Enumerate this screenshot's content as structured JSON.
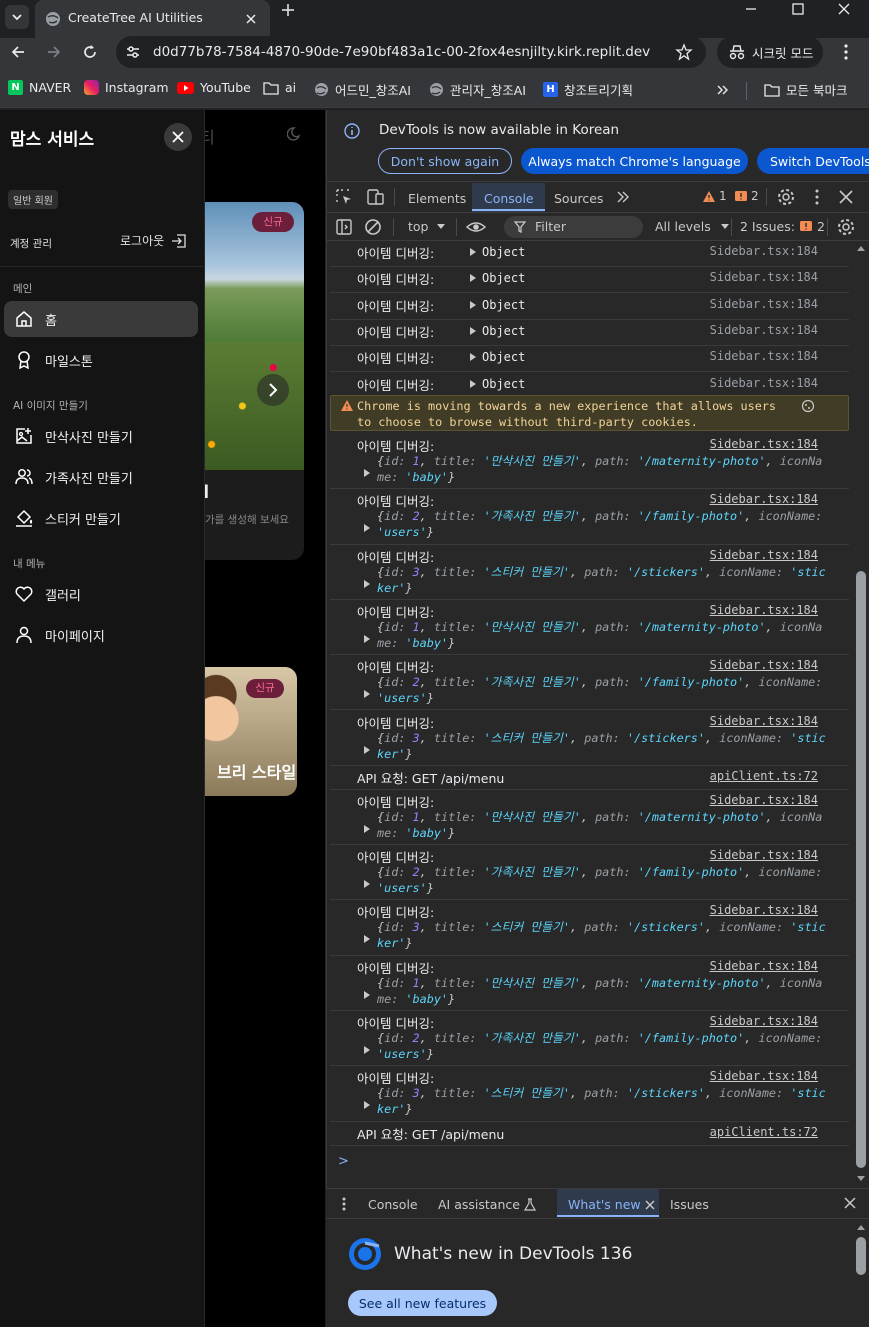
{
  "browser": {
    "tab_title": "CreateTree AI Utilities",
    "url": "d0d77b78-7584-4870-90de-7e90bf483a1c-00-2fox4esnjilty.kirk.replit.dev",
    "incognito_label": "시크릿 모드",
    "bookmarks": [
      {
        "label": "NAVER",
        "icon": "naver-icon"
      },
      {
        "label": "Instagram",
        "icon": "instagram-icon"
      },
      {
        "label": "YouTube",
        "icon": "youtube-icon"
      },
      {
        "label": "ai",
        "icon": "folder-icon"
      },
      {
        "label": "어드민_창조AI",
        "icon": "globe-icon"
      },
      {
        "label": "관리자_창조AI",
        "icon": "globe-icon"
      },
      {
        "label": "창조트리기획",
        "icon": "h-icon"
      }
    ],
    "all_bookmarks": "모든 북마크"
  },
  "sidebar": {
    "title": "맘스 서비스",
    "member_badge": "일반 회원",
    "account_label": "계정 관리",
    "logout_label": "로그아웃",
    "sections": {
      "main": "메인",
      "ai_image": "AI 이미지 만들기",
      "my_menu": "내 메뉴"
    },
    "items": [
      {
        "label": "홈",
        "icon": "home-icon",
        "active": true
      },
      {
        "label": "마일스톤",
        "icon": "award-icon"
      },
      {
        "label": "만삭사진 만들기",
        "icon": "image-plus-icon"
      },
      {
        "label": "가족사진 만들기",
        "icon": "users-icon"
      },
      {
        "label": "스티커 만들기",
        "icon": "paint-bucket-icon"
      },
      {
        "label": "갤러리",
        "icon": "heart-icon"
      },
      {
        "label": "마이페이지",
        "icon": "user-icon"
      }
    ]
  },
  "background": {
    "header_partial": "티",
    "card1_badge": "신규",
    "card1_title_partial": "l",
    "card1_desc_partial": "가를 생성해 보세요",
    "card2_badge": "신규",
    "card2_title_partial": "브리 스타일"
  },
  "devtools": {
    "banner_text": "DevTools is now available in Korean",
    "banner_btn1": "Don't show again",
    "banner_btn2": "Always match Chrome's language",
    "banner_btn3": "Switch DevTools",
    "tabs": [
      "Elements",
      "Console",
      "Sources"
    ],
    "warn_count": "1",
    "issue_count": "2",
    "context": "top",
    "filter_placeholder": "Filter",
    "levels": "All levels",
    "issues_label": "2 Issues:",
    "issues_num": "2",
    "log": {
      "debug_label": "아이템 디버깅:",
      "object_label": "Object",
      "source": "Sidebar.tsx:184",
      "api_msg": "API 요청: GET /api/menu",
      "api_source": "apiClient.ts:72",
      "warning": "Chrome is moving towards a new experience that allows users to choose to browse without third-party cookies."
    },
    "objects": [
      "{id: 1, title: '만삭사진 만들기', path: '/maternity-photo', iconName: 'baby'}",
      "{id: 2, title: '가족사진 만들기', path: '/family-photo', iconName: 'users'}",
      "{id: 3, title: '스티커 만들기', path: '/stickers', iconName: 'sticker'}"
    ],
    "drawer_tabs": [
      "Console",
      "AI assistance",
      "What's new",
      "Issues"
    ],
    "whats_new_title": "What's new in DevTools 136",
    "see_all": "See all new features",
    "prompt": ">"
  }
}
